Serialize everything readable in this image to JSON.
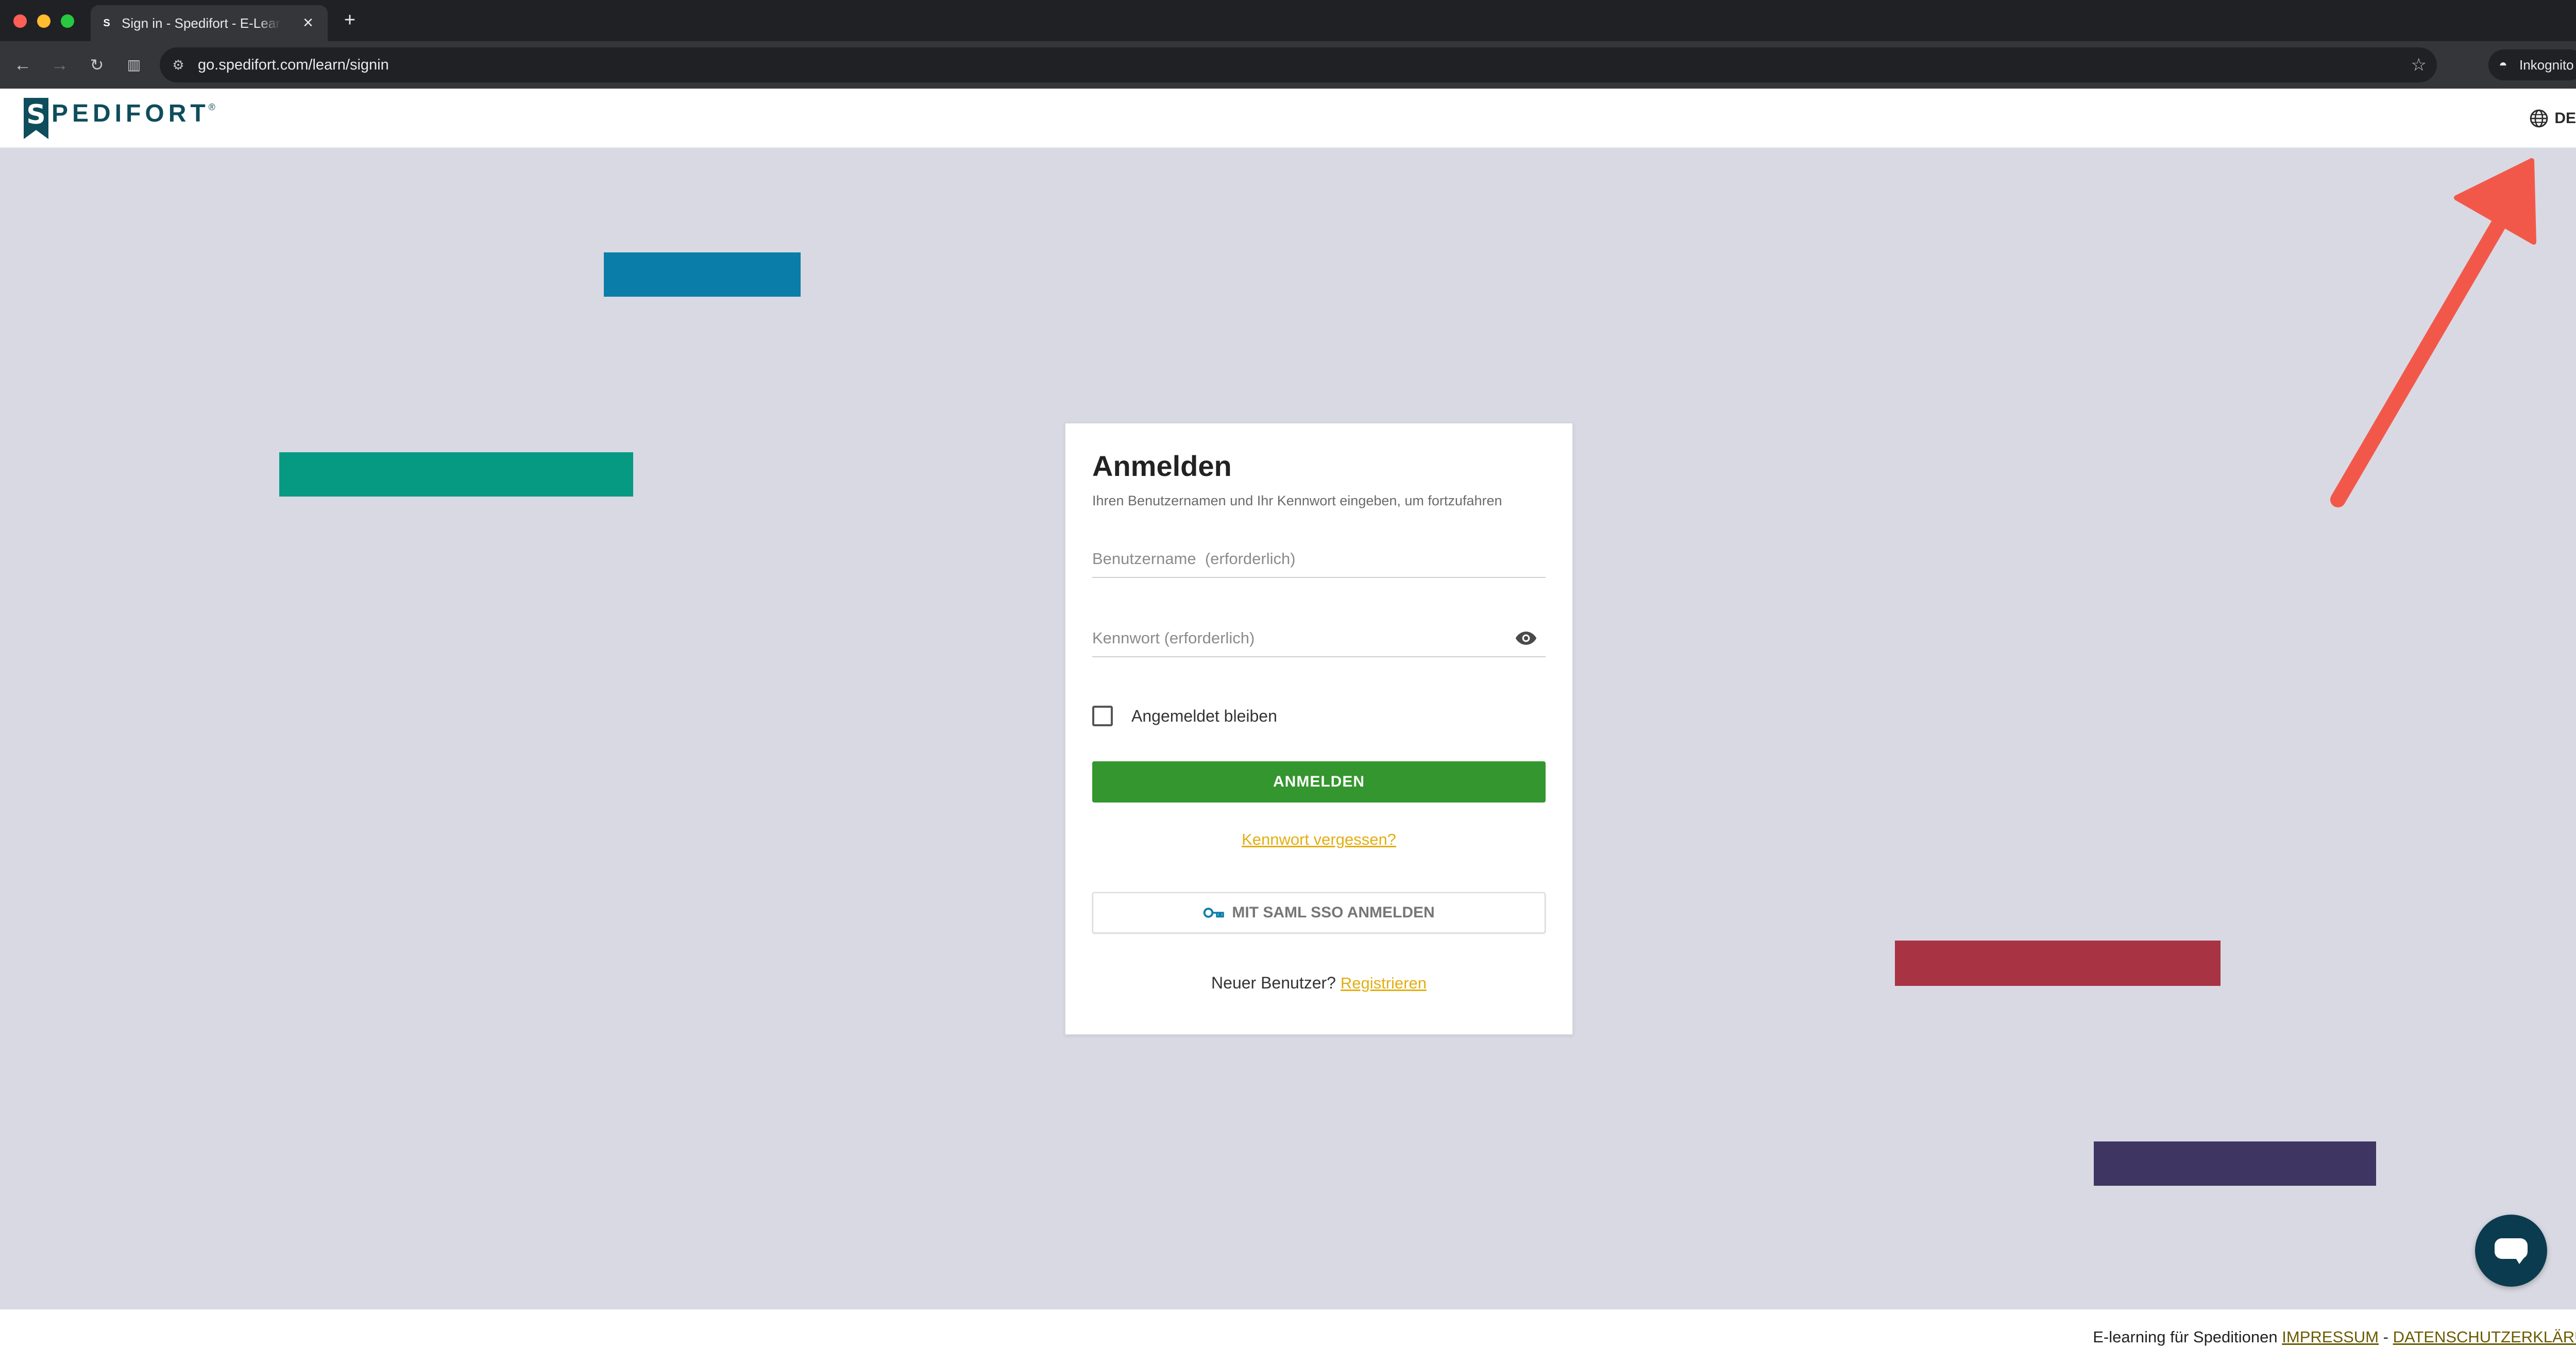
{
  "browser": {
    "tab_title": "Sign in - Spedifort - E-Learning",
    "tab_favicon": "S",
    "url": "go.spedifort.com/learn/signin",
    "incognito_label": "Inkognito"
  },
  "header": {
    "logo_mark": "S",
    "logo_text": "PEDIFORT",
    "logo_registered": "®",
    "language": "DE"
  },
  "login": {
    "title": "Anmelden",
    "subtitle": "Ihren Benutzernamen und Ihr Kennwort eingeben, um fortzufahren",
    "username_placeholder": "Benutzername  (erforderlich)",
    "password_placeholder": "Kennwort (erforderlich)",
    "remember_label": "Angemeldet bleiben",
    "submit_label": "ANMELDEN",
    "forgot_label": "Kennwort vergessen?",
    "sso_label": "MIT SAML SSO ANMELDEN",
    "new_user_text": "Neuer Benutzer?",
    "register_label": "Registrieren"
  },
  "footer": {
    "text": "E-learning für Speditionen",
    "impressum": "IMPRESSUM",
    "separator": "-",
    "privacy": "DATENSCHUTZERKLÄRUNG"
  },
  "colors": {
    "bar_blue": "#0a7ea8",
    "bar_teal": "#069a83",
    "bar_red": "#a83343",
    "bar_purple": "#3f3563",
    "primary_green": "#34962e",
    "link_yellow": "#e2ae12",
    "annotation_arrow": "#f2584a"
  },
  "icons": {
    "globe": "globe-icon",
    "eye": "eye-icon",
    "key": "key-icon",
    "chat": "chat-icon"
  }
}
